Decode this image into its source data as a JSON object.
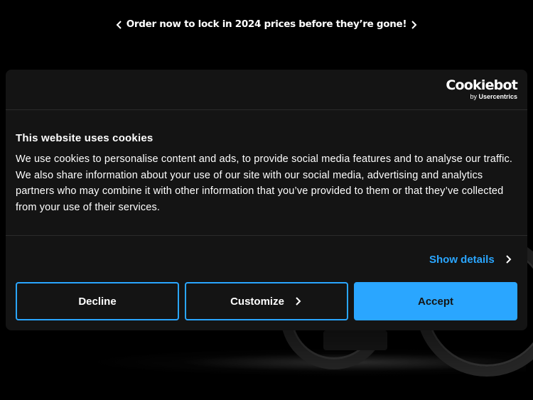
{
  "announcement": {
    "message": "Order now to lock in 2024 prices before they’re gone!",
    "prev_icon": "chevron-left-icon",
    "next_icon": "chevron-right-icon"
  },
  "cookie_dialog": {
    "logo": {
      "brand": "Cookiebot",
      "sub_prefix": "by ",
      "sub_brand": "Usercentrics"
    },
    "title": "This website uses cookies",
    "body": "We use cookies to personalise content and ads, to provide social media features and to analyse our traffic. We also share information about your use of our site with our social media, advertising and analytics partners who may combine it with other information that you’ve provided to them or that they’ve collected from your use of their services.",
    "show_details_label": "Show details",
    "buttons": {
      "decline": "Decline",
      "customize": "Customize",
      "accept": "Accept"
    }
  },
  "colors": {
    "accent": "#2aa6ff",
    "dialog_bg": "#141414",
    "page_bg": "#000000"
  }
}
